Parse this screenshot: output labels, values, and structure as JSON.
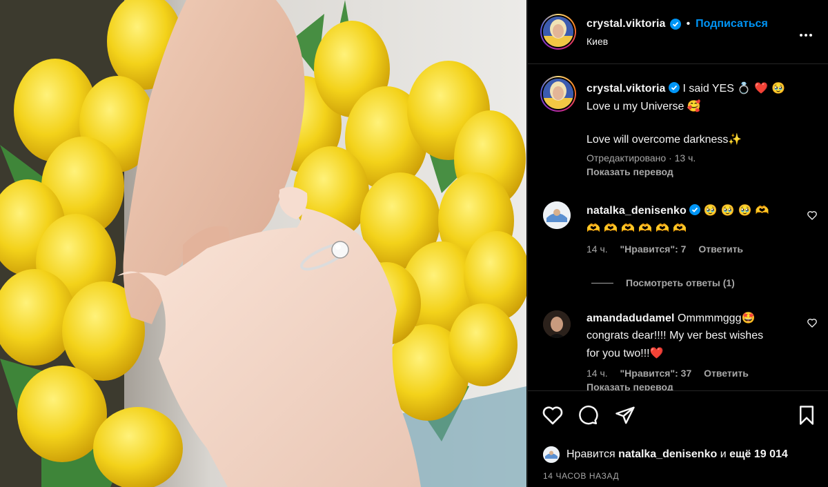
{
  "post_header": {
    "username": "crystal.viktoria",
    "follow_label": "Подписаться",
    "location": "Киев"
  },
  "caption": {
    "username": "crystal.viktoria",
    "line1_text": "I said YES",
    "line1_emojis": "💍 ❤️ 🥹",
    "line2_text": "Love u my Universe",
    "line2_emoji": "🥰",
    "line3_text": "Love will overcome darkness",
    "line3_emoji": "✨",
    "edited_meta": "Отредактировано · 13 ч.",
    "show_translation": "Показать перевод"
  },
  "comments": [
    {
      "username": "natalka_denisenko",
      "verified": true,
      "text_emojis_line1": "🥹 🥹 🥹 🫶",
      "text_emojis_line2": "🫶 🫶 🫶 🫶 🫶 🫶",
      "time": "14 ч.",
      "likes": "\"Нравится\": 7",
      "reply": "Ответить",
      "view_replies": "Посмотреть ответы (1)"
    },
    {
      "username": "amandadudamel",
      "verified": false,
      "text_line1": "Ommmmggg",
      "text_line1_emoji": "🤩",
      "text_line2": "congrats dear!!!! My ver best wishes",
      "text_line3": "for you two!!!",
      "text_line3_emoji": "❤️",
      "time": "14 ч.",
      "likes": "\"Нравится\": 37",
      "reply": "Ответить",
      "show_translation_partial": "Показать перевод"
    }
  ],
  "likes_summary": {
    "prefix": "Нравится",
    "username": "natalka_denisenko",
    "middle": "и",
    "count": "ещё 19 014"
  },
  "time_ago": "14 ЧАСОВ НАЗАД",
  "icons": [
    "heart-icon",
    "comment-icon",
    "share-icon",
    "bookmark-icon",
    "more-icon",
    "verified-icon"
  ],
  "colors": {
    "link_blue": "#0095f6",
    "muted": "#a8a8a8",
    "verified": "#0095f6",
    "background": "#000000"
  }
}
